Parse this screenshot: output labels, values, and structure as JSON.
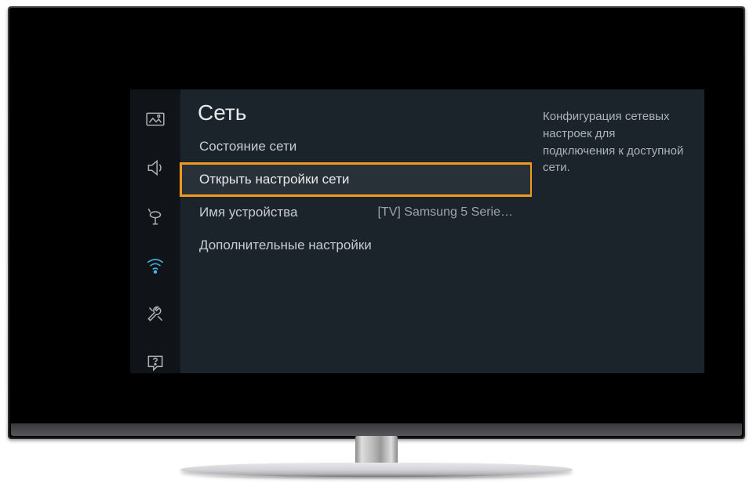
{
  "title": "Сеть",
  "description": "Конфигурация сетевых настроек для подключения к доступной сети.",
  "sidebar": {
    "items": [
      {
        "name": "picture-icon",
        "active": false
      },
      {
        "name": "sound-icon",
        "active": false
      },
      {
        "name": "broadcast-icon",
        "active": false
      },
      {
        "name": "network-icon",
        "active": true
      },
      {
        "name": "tools-icon",
        "active": false
      },
      {
        "name": "support-icon",
        "active": false
      }
    ]
  },
  "menu": {
    "items": [
      {
        "label": "Состояние сети",
        "value": "",
        "highlight": false
      },
      {
        "label": "Открыть настройки сети",
        "value": "",
        "highlight": true
      },
      {
        "label": "Имя устройства",
        "value": "[TV] Samsung 5 Serie…",
        "highlight": false
      },
      {
        "label": "Дополнительные настройки",
        "value": "",
        "highlight": false
      }
    ]
  }
}
